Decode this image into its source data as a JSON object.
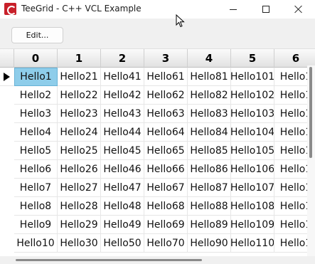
{
  "window": {
    "title": "TeeGrid - C++ VCL Example"
  },
  "toolbar": {
    "edit_label": "Edit..."
  },
  "grid": {
    "columns": [
      "0",
      "1",
      "2",
      "3",
      "4",
      "5",
      "6"
    ],
    "rows": [
      [
        "Hello1",
        "Hello21",
        "Hello41",
        "Hello61",
        "Hello81",
        "Hello101",
        "Hello1"
      ],
      [
        "Hello2",
        "Hello22",
        "Hello42",
        "Hello62",
        "Hello82",
        "Hello102",
        "Hello1"
      ],
      [
        "Hello3",
        "Hello23",
        "Hello43",
        "Hello63",
        "Hello83",
        "Hello103",
        "Hello1"
      ],
      [
        "Hello4",
        "Hello24",
        "Hello44",
        "Hello64",
        "Hello84",
        "Hello104",
        "Hello1"
      ],
      [
        "Hello5",
        "Hello25",
        "Hello45",
        "Hello65",
        "Hello85",
        "Hello105",
        "Hello1"
      ],
      [
        "Hello6",
        "Hello26",
        "Hello46",
        "Hello66",
        "Hello86",
        "Hello106",
        "Hello1"
      ],
      [
        "Hello7",
        "Hello27",
        "Hello47",
        "Hello67",
        "Hello87",
        "Hello107",
        "Hello1"
      ],
      [
        "Hello8",
        "Hello28",
        "Hello48",
        "Hello68",
        "Hello88",
        "Hello108",
        "Hello1"
      ],
      [
        "Hello9",
        "Hello29",
        "Hello49",
        "Hello69",
        "Hello89",
        "Hello109",
        "Hello1"
      ],
      [
        "Hello10",
        "Hello30",
        "Hello50",
        "Hello70",
        "Hello90",
        "Hello110",
        "Hello1"
      ]
    ],
    "selected_cell": "Hello1",
    "selected_color": "#8ecdea"
  },
  "icons": {
    "app": "teegrid-app-icon",
    "minimize": "minimize-icon",
    "maximize": "maximize-icon",
    "close": "close-icon",
    "row_indicator": "row-indicator-arrow-icon",
    "cursor": "mouse-cursor-icon"
  }
}
